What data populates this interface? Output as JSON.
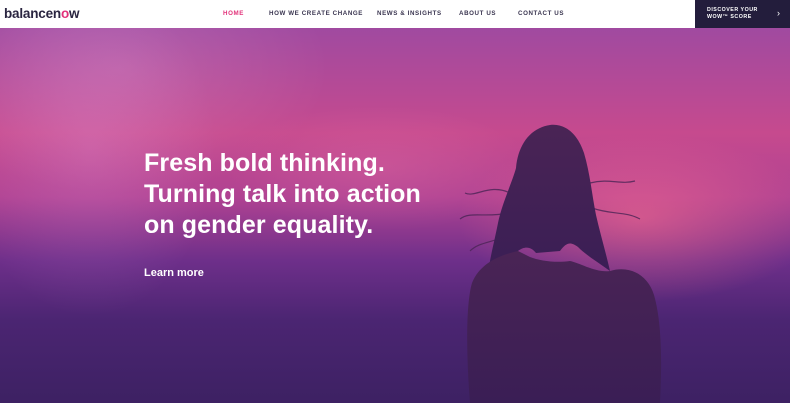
{
  "brand": {
    "logo_text_before": "balancen",
    "logo_mark": "o",
    "logo_text_after": "w"
  },
  "nav": {
    "items": [
      {
        "label": "HOME",
        "active": true
      },
      {
        "label": "HOW WE CREATE CHANGE",
        "active": false
      },
      {
        "label": "NEWS & INSIGHTS",
        "active": false
      },
      {
        "label": "ABOUT US",
        "active": false
      },
      {
        "label": "CONTACT US",
        "active": false
      }
    ],
    "cta": {
      "label": "DISCOVER YOUR\nWOW™ SCORE",
      "icon": "chevron-right-icon",
      "arrow": "›"
    }
  },
  "hero": {
    "headline_lines": [
      "Fresh bold thinking.",
      "Turning talk into action",
      "on gender equality."
    ],
    "link": "Learn more"
  },
  "colors": {
    "accent": "#e2327a",
    "cta_background": "#231d3c",
    "nav_text": "#3a3550"
  }
}
